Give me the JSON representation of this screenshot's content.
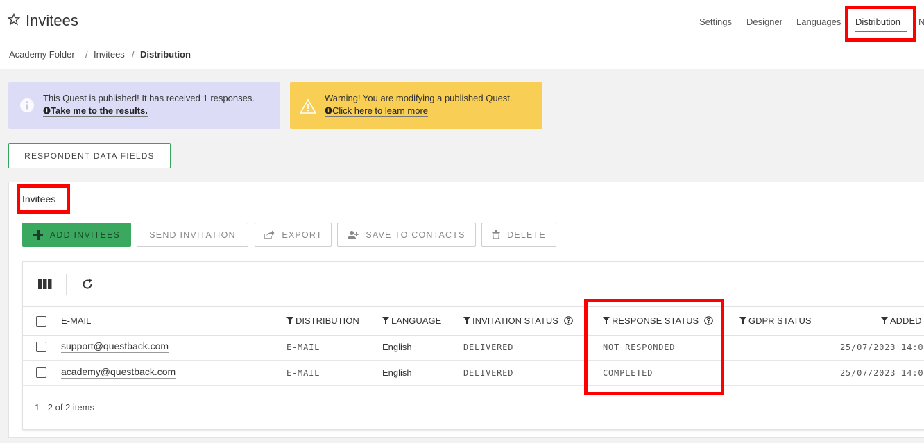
{
  "header": {
    "title": "Invitees",
    "nav": [
      "Settings",
      "Designer",
      "Languages",
      "Distribution",
      "N"
    ],
    "active_nav": "Distribution"
  },
  "breadcrumb": [
    "Academy Folder",
    "Invitees",
    "Distribution"
  ],
  "info_banner": {
    "text": "This Quest is published! It has received 1 responses.",
    "link": "Take me to the results."
  },
  "warning_banner": {
    "text": "Warning! You are modifying a published Quest.",
    "link": "Click here to learn more"
  },
  "respondent_button": "RESPONDENT DATA FIELDS",
  "invitees": {
    "title": "Invitees",
    "actions": {
      "add": "ADD INVITEES",
      "send": "SEND INVITATION",
      "export": "EXPORT",
      "save": "SAVE TO CONTACTS",
      "delete": "DELETE"
    },
    "columns": [
      "E-MAIL",
      "DISTRIBUTION",
      "LANGUAGE",
      "INVITATION STATUS",
      "RESPONSE STATUS",
      "GDPR STATUS",
      "ADDED"
    ],
    "rows": [
      {
        "email": "support@questback.com",
        "distribution": "E-MAIL",
        "language": "English",
        "invitation_status": "DELIVERED",
        "response_status": "NOT RESPONDED",
        "gdpr_status": "",
        "added": "25/07/2023 14:0"
      },
      {
        "email": "academy@questback.com",
        "distribution": "E-MAIL",
        "language": "English",
        "invitation_status": "DELIVERED",
        "response_status": "COMPLETED",
        "gdpr_status": "",
        "added": "25/07/2023 14:0"
      }
    ],
    "footer": "1 - 2 of 2 items"
  },
  "colors": {
    "accent_green": "#3aa85e",
    "info_bg": "#dcdcf7",
    "warning_bg": "#f8cf54",
    "highlight_red": "#ff0000"
  }
}
